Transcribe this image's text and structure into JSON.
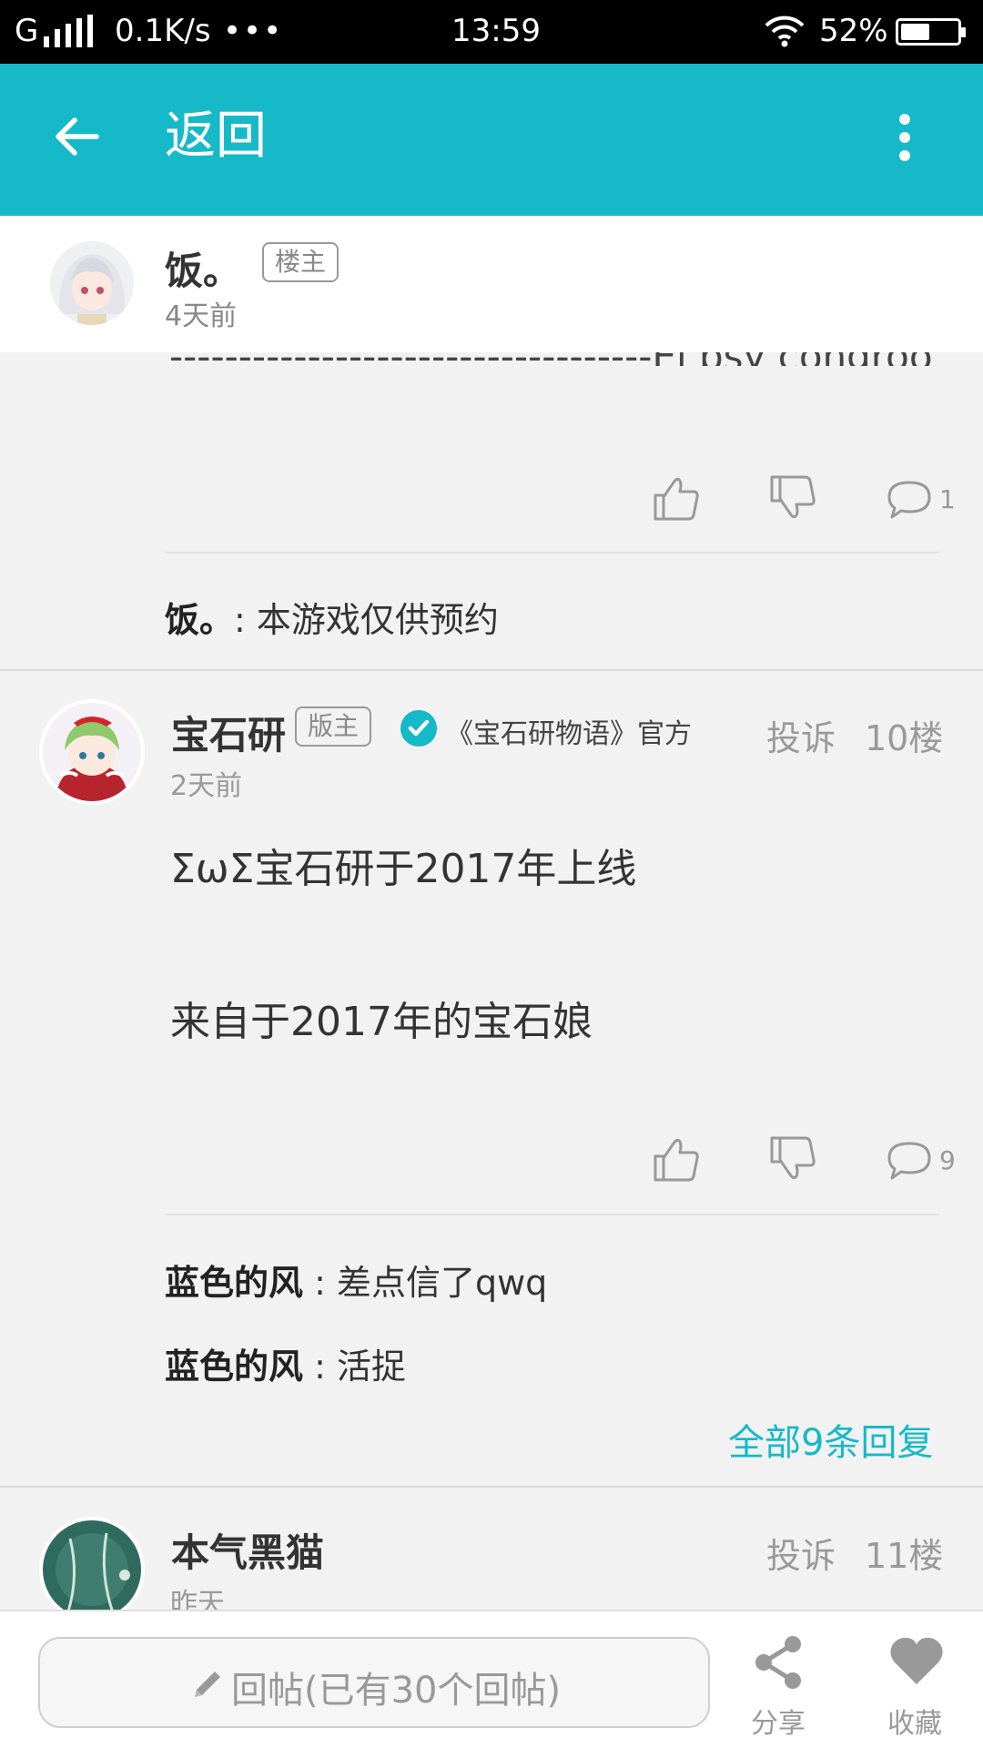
{
  "status_bar": {
    "carrier": "G",
    "speed": "0.1K/s",
    "dots": "•••",
    "time": "13:59",
    "battery": "52%",
    "battery_level": 0.52
  },
  "toolbar": {
    "title": "返回",
    "back_icon": "arrow-left-icon",
    "more_icon": "more-vertical-icon"
  },
  "op": {
    "name": "饭。",
    "tag": "楼主",
    "time": "4天前",
    "cut_text": "-----------------------------------El psy congroo !",
    "comments": "1",
    "reply": {
      "user": "饭。",
      "text": ": 本游戏仅供预约"
    }
  },
  "post10": {
    "name": "宝石研",
    "tag": "版主",
    "official": "《宝石研物语》官方",
    "report": "投诉",
    "floor": "10楼",
    "time": "2天前",
    "body_line1": "ΣωΣ宝石研于2017年上线",
    "body_line2": "来自于2017年的宝石娘",
    "comments": "9",
    "replies": [
      {
        "user": "蓝色的风",
        "text": " : 差点信了qwq"
      },
      {
        "user": "蓝色的风",
        "text": " : 活捉"
      }
    ],
    "all_replies": "全部9条回复"
  },
  "post11": {
    "name": "本气黑猫",
    "report": "投诉",
    "floor": "11楼",
    "time": "昨天"
  },
  "bottom_bar": {
    "reply_placeholder": "回帖(已有30个回帖)",
    "share_label": "分享",
    "favorite_label": "收藏"
  },
  "colors": {
    "accent": "#16b9c8",
    "background": "#f2f2f2"
  }
}
